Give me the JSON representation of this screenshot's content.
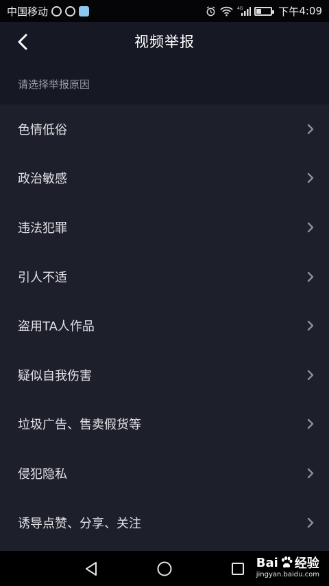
{
  "status_bar": {
    "carrier": "中国移动",
    "network_type": "4G",
    "time_prefix": "下午",
    "time": "4:09"
  },
  "header": {
    "title": "视频举报"
  },
  "section": {
    "label": "请选择举报原因"
  },
  "reasons": [
    {
      "label": "色情低俗"
    },
    {
      "label": "政治敏感"
    },
    {
      "label": "违法犯罪"
    },
    {
      "label": "引人不适"
    },
    {
      "label": "盗用TA人作品"
    },
    {
      "label": "疑似自我伤害"
    },
    {
      "label": "垃圾广告、售卖假货等"
    },
    {
      "label": "侵犯隐私"
    },
    {
      "label": "诱导点赞、分享、关注"
    }
  ],
  "watermark": {
    "brand_left": "Bai",
    "brand_right": "经验",
    "url": "jingyan.baidu.com"
  },
  "colors": {
    "background": "#1d1f2b",
    "header": "#161823",
    "text_primary": "#e3e3e7",
    "text_secondary": "#9a9ba3"
  }
}
